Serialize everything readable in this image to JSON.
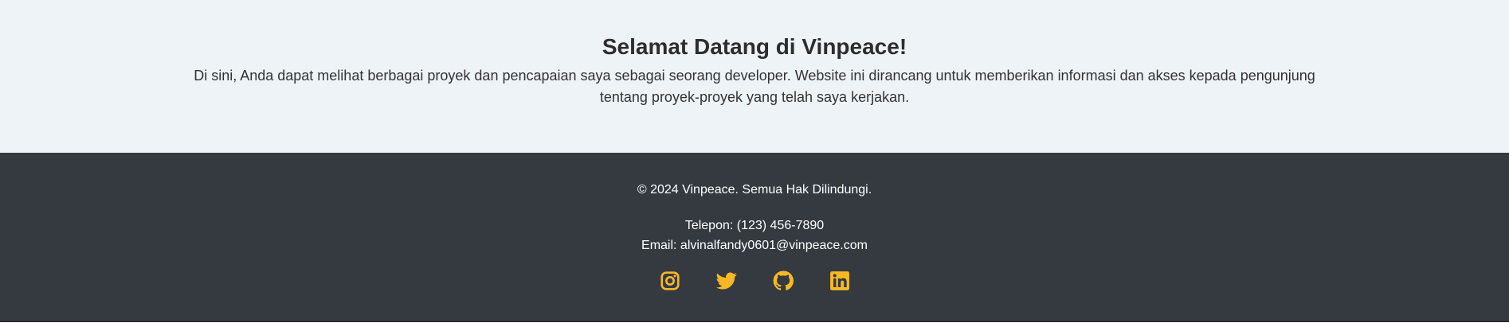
{
  "welcome": {
    "title": "Selamat Datang di Vinpeace!",
    "description": "Di sini, Anda dapat melihat berbagai proyek dan pencapaian saya sebagai seorang developer. Website ini dirancang untuk memberikan informasi dan akses kepada pengunjung tentang proyek-proyek yang telah saya kerjakan."
  },
  "footer": {
    "copyright": "© 2024 Vinpeace. Semua Hak Dilindungi.",
    "phone": "Telepon: (123) 456-7890",
    "email": "Email: alvinalfandy0601@vinpeace.com",
    "social_icon_color": "#f7b824",
    "socials": [
      {
        "icon": "instagram-icon"
      },
      {
        "icon": "twitter-icon"
      },
      {
        "icon": "github-icon"
      },
      {
        "icon": "linkedin-icon"
      }
    ]
  }
}
